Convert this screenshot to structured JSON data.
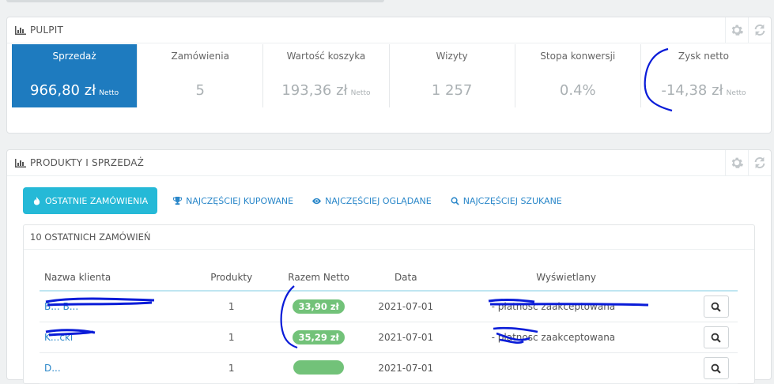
{
  "dashboard": {
    "title": "PULPIT",
    "kpis": [
      {
        "label": "Sprzedaż",
        "value": "966,80 zł",
        "unit": "Netto",
        "active": true
      },
      {
        "label": "Zamówienia",
        "value": "5",
        "unit": ""
      },
      {
        "label": "Wartość koszyka",
        "value": "193,36 zł",
        "unit": "Netto"
      },
      {
        "label": "Wizyty",
        "value": "1 257",
        "unit": ""
      },
      {
        "label": "Stopa konwersji",
        "value": "0.4%",
        "unit": ""
      },
      {
        "label": "Zysk netto",
        "value": "-14,38 zł",
        "unit": "Netto"
      }
    ]
  },
  "products": {
    "title": "PRODUKTY I SPRZEDAŻ",
    "tabs": [
      {
        "label": "OSTATNIE ZAMÓWIENIA",
        "icon": "fire-icon"
      },
      {
        "label": "NAJCZĘŚCIEJ KUPOWANE",
        "icon": "trophy-icon"
      },
      {
        "label": "NAJCZĘŚCIEJ OGLĄDANE",
        "icon": "eye-icon"
      },
      {
        "label": "NAJCZĘŚCIEJ SZUKANE",
        "icon": "search-icon"
      }
    ],
    "orders_title": "10 OSTATNICH ZAMÓWIEŃ",
    "columns": [
      "Nazwa klienta",
      "Produkty",
      "Razem Netto",
      "Data",
      "Wyświetlany"
    ],
    "rows": [
      {
        "client": "B... B...",
        "products": "1",
        "total": "33,90 zł",
        "date": "2021-07-01",
        "status": "- płatnosc zaakceptowana"
      },
      {
        "client": "K...cki",
        "products": "1",
        "total": "35,29 zł",
        "date": "2021-07-01",
        "status": "- płatnosc zaakceptowana"
      },
      {
        "client": "D...",
        "products": "1",
        "total": "",
        "date": "2021-07-01",
        "status": ""
      }
    ]
  },
  "colors": {
    "accent": "#25b9d7",
    "active_kpi": "#1e7bbf",
    "badge": "#72c279"
  }
}
